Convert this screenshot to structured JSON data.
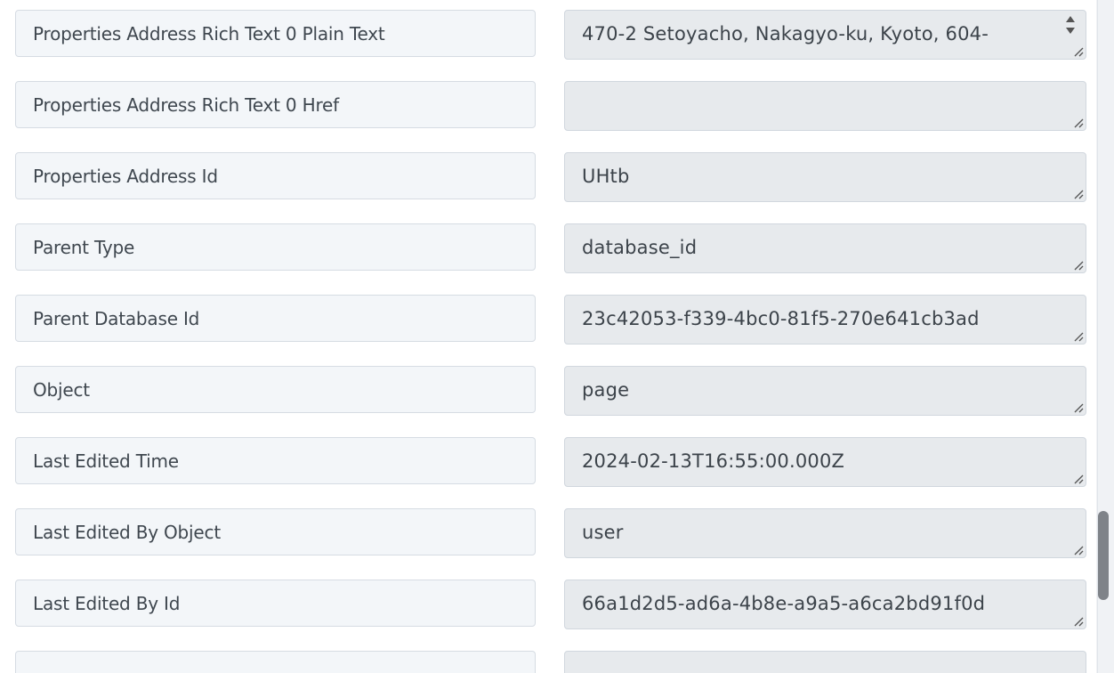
{
  "rows": [
    {
      "label": "Properties Address Rich Text 0 Plain Text",
      "value": "470-2 Setoyacho, Nakagyo-ku, Kyoto, 604-"
    },
    {
      "label": "Properties Address Rich Text 0 Href",
      "value": ""
    },
    {
      "label": "Properties Address Id",
      "value": "UHtb"
    },
    {
      "label": "Parent Type",
      "value": "database_id"
    },
    {
      "label": "Parent Database Id",
      "value": "23c42053-f339-4bc0-81f5-270e641cb3ad"
    },
    {
      "label": "Object",
      "value": "page"
    },
    {
      "label": "Last Edited Time",
      "value": "2024-02-13T16:55:00.000Z"
    },
    {
      "label": "Last Edited By Object",
      "value": "user"
    },
    {
      "label": "Last Edited By Id",
      "value": "66a1d2d5-ad6a-4b8e-a9a5-a6ca2bd91f0d"
    },
    {
      "label": "",
      "value": ""
    }
  ],
  "icons": {
    "resize": "resize-grip-icon",
    "spinner_up": "triangle-up-icon",
    "spinner_down": "triangle-down-icon"
  },
  "colors": {
    "label_bg": "#f3f6f9",
    "value_bg": "#e7eaed",
    "border": "#d6dce3",
    "text": "#3f474f",
    "scrollbar_thumb": "#7f8389"
  }
}
